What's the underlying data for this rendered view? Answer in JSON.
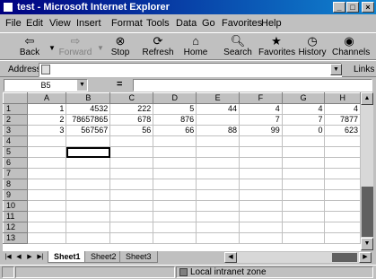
{
  "window": {
    "title": "test - Microsoft Internet Explorer",
    "minimize": "_",
    "maximize": "□",
    "close": "×"
  },
  "menu": [
    "File",
    "Edit",
    "View",
    "Insert",
    "Format",
    "Tools",
    "Data",
    "Go",
    "Favorites",
    "Help"
  ],
  "toolbar": {
    "back": "Back",
    "forward": "Forward",
    "stop": "Stop",
    "refresh": "Refresh",
    "home": "Home",
    "search": "Search",
    "favorites": "Favorites",
    "history": "History",
    "channels": "Channels"
  },
  "address": {
    "label": "Address",
    "value": "",
    "links": "Links"
  },
  "formula_bar": {
    "name_box": "B5",
    "equals": "=",
    "content": ""
  },
  "sheet": {
    "columns": [
      "A",
      "B",
      "C",
      "D",
      "E",
      "F",
      "G",
      "H"
    ],
    "rows": [
      {
        "num": "1",
        "cells": [
          "1",
          "4532",
          "222",
          "5",
          "44",
          "4",
          "4",
          "4"
        ]
      },
      {
        "num": "2",
        "cells": [
          "2",
          "78657865",
          "678",
          "876",
          "",
          "7",
          "7",
          "7877"
        ]
      },
      {
        "num": "3",
        "cells": [
          "3",
          "567567",
          "56",
          "66",
          "88",
          "99",
          "0",
          "623"
        ]
      },
      {
        "num": "4",
        "cells": [
          "",
          "",
          "",
          "",
          "",
          "",
          "",
          ""
        ]
      },
      {
        "num": "5",
        "cells": [
          "",
          "",
          "",
          "",
          "",
          "",
          "",
          ""
        ]
      },
      {
        "num": "6",
        "cells": [
          "",
          "",
          "",
          "",
          "",
          "",
          "",
          ""
        ]
      },
      {
        "num": "7",
        "cells": [
          "",
          "",
          "",
          "",
          "",
          "",
          "",
          ""
        ]
      },
      {
        "num": "8",
        "cells": [
          "",
          "",
          "",
          "",
          "",
          "",
          "",
          ""
        ]
      },
      {
        "num": "9",
        "cells": [
          "",
          "",
          "",
          "",
          "",
          "",
          "",
          ""
        ]
      },
      {
        "num": "10",
        "cells": [
          "",
          "",
          "",
          "",
          "",
          "",
          "",
          ""
        ]
      },
      {
        "num": "11",
        "cells": [
          "",
          "",
          "",
          "",
          "",
          "",
          "",
          ""
        ]
      },
      {
        "num": "12",
        "cells": [
          "",
          "",
          "",
          "",
          "",
          "",
          "",
          ""
        ]
      },
      {
        "num": "13",
        "cells": [
          "",
          "",
          "",
          "",
          "",
          "",
          "",
          ""
        ]
      }
    ],
    "tabs": [
      "Sheet1",
      "Sheet2",
      "Sheet3"
    ]
  },
  "status": {
    "zone": "Local intranet zone"
  },
  "icons": {
    "back": "back-arrow-icon",
    "forward": "forward-arrow-icon",
    "stop": "stop-icon",
    "refresh": "refresh-icon",
    "home": "home-icon",
    "search": "search-icon",
    "favorites": "favorites-icon",
    "history": "history-icon",
    "channels": "channels-icon"
  },
  "colors": {
    "titlebar_start": "#000080",
    "titlebar_end": "#1084d0",
    "chrome": "#c0c0c0"
  }
}
